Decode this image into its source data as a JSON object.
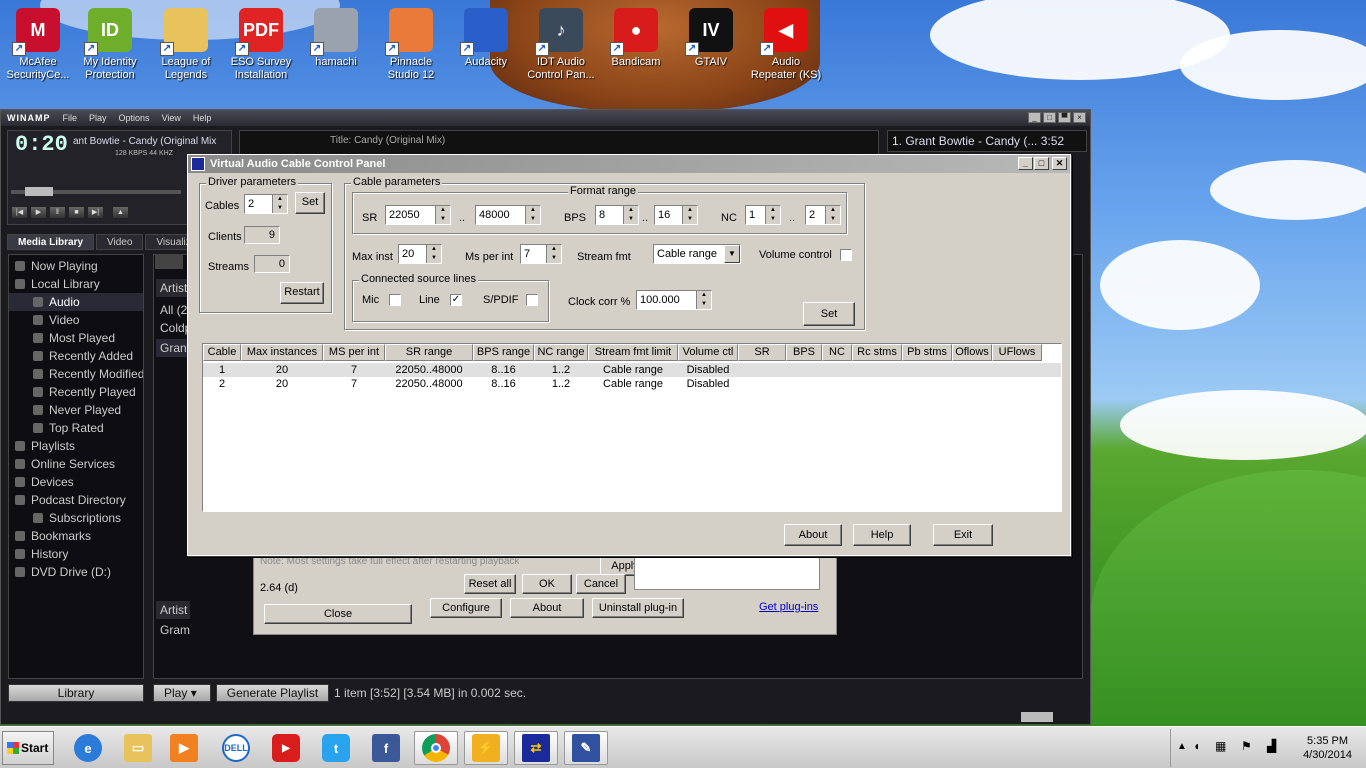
{
  "desktop": {
    "icons": [
      {
        "label1": "McAfee",
        "label2": "SecurityCe...",
        "icon": "mcafee-icon",
        "color": "#c8102e",
        "glyph": "M"
      },
      {
        "label1": "My Identity",
        "label2": "Protection",
        "icon": "identity-icon",
        "color": "#6fae2a",
        "glyph": "ID"
      },
      {
        "label1": "League of",
        "label2": "Legends",
        "icon": "folder-icon",
        "color": "#e8c25a",
        "glyph": ""
      },
      {
        "label1": "ESO Survey",
        "label2": "Installation",
        "icon": "pdf-icon",
        "color": "#e02424",
        "glyph": "PDF"
      },
      {
        "label1": "hamachi",
        "label2": "",
        "icon": "hamachi-icon",
        "color": "#9aa3ad",
        "glyph": ""
      },
      {
        "label1": "Pinnacle",
        "label2": "Studio 12",
        "icon": "pinnacle-icon",
        "color": "#e97a3a",
        "glyph": ""
      },
      {
        "label1": "Audacity",
        "label2": "",
        "icon": "audacity-icon",
        "color": "#2a5ec8",
        "glyph": ""
      },
      {
        "label1": "IDT Audio",
        "label2": "Control Pan...",
        "icon": "idt-audio-icon",
        "color": "#3a4a5a",
        "glyph": "♪"
      },
      {
        "label1": "Bandicam",
        "label2": "",
        "icon": "bandicam-icon",
        "color": "#d81c1c",
        "glyph": "●"
      },
      {
        "label1": "GTAIV",
        "label2": "",
        "icon": "gtaiv-icon",
        "color": "#111111",
        "glyph": "IV"
      },
      {
        "label1": "Audio",
        "label2": "Repeater (KS)",
        "icon": "audio-repeater-icon",
        "color": "#e01010",
        "glyph": "◀"
      }
    ]
  },
  "winamp": {
    "title": "WINAMP",
    "menu": [
      "File",
      "Play",
      "Options",
      "View",
      "Help"
    ],
    "time": "0:20",
    "track": "ant Bowtie - Candy (Original Mix",
    "kbps": "128 KBPS  44 KHZ",
    "video_title": "Title: Candy (Original Mix)",
    "playlist_entry": "1. Grant Bowtie - Candy (...   3:52",
    "tabs": [
      "Media Library",
      "Video",
      "Visualiza"
    ],
    "tree": [
      {
        "label": "Now Playing",
        "indent": 0,
        "sel": false
      },
      {
        "label": "Local Library",
        "indent": 0,
        "sel": false
      },
      {
        "label": "Audio",
        "indent": 1,
        "sel": true
      },
      {
        "label": "Video",
        "indent": 1,
        "sel": false
      },
      {
        "label": "Most Played",
        "indent": 1,
        "sel": false
      },
      {
        "label": "Recently Added",
        "indent": 1,
        "sel": false
      },
      {
        "label": "Recently Modified",
        "indent": 1,
        "sel": false
      },
      {
        "label": "Recently Played",
        "indent": 1,
        "sel": false
      },
      {
        "label": "Never Played",
        "indent": 1,
        "sel": false
      },
      {
        "label": "Top Rated",
        "indent": 1,
        "sel": false
      },
      {
        "label": "Playlists",
        "indent": 0,
        "sel": false
      },
      {
        "label": "Online Services",
        "indent": 0,
        "sel": false
      },
      {
        "label": "Devices",
        "indent": 0,
        "sel": false
      },
      {
        "label": "Podcast Directory",
        "indent": 0,
        "sel": false
      },
      {
        "label": "Subscriptions",
        "indent": 1,
        "sel": false
      },
      {
        "label": "Bookmarks",
        "indent": 0,
        "sel": false
      },
      {
        "label": "History",
        "indent": 0,
        "sel": false
      },
      {
        "label": "DVD Drive (D:)",
        "indent": 0,
        "sel": false
      }
    ],
    "artist_header": "Artist",
    "all_row": "All (2",
    "cold_row": "Coldp",
    "grant_row": "Grant",
    "artist_header2": "Artist",
    "grant_row2": "Gram",
    "library_button": "Library",
    "play_button": "Play",
    "generate_playlist": "Generate Playlist",
    "status": "1 item [3:52] [3.54 MB] in 0.002 sec."
  },
  "plugin_dialog": {
    "note": "Note: Most settings take full effect after restarting playback",
    "apply": "Apply",
    "reset_all": "Reset all",
    "ok": "OK",
    "cancel": "Cancel",
    "version": "2.64 (d)",
    "close": "Close",
    "configure": "Configure",
    "about": "About",
    "uninstall": "Uninstall plug-in",
    "get_plugins": "Get plug-ins"
  },
  "vac": {
    "title": "Virtual Audio Cable Control Panel",
    "driver": {
      "group": "Driver parameters",
      "cables_label": "Cables",
      "cables_value": "2",
      "set": "Set",
      "clients_label": "Clients",
      "clients_value": "9",
      "streams_label": "Streams",
      "streams_value": "0",
      "restart": "Restart"
    },
    "cable": {
      "group": "Cable parameters",
      "format_group": "Format range",
      "sr_label": "SR",
      "sr_min": "22050",
      "sr_max": "48000",
      "dots": "..",
      "bps_label": "BPS",
      "bps_min": "8",
      "bps_max": "16",
      "nc_label": "NC",
      "nc_min": "1",
      "nc_max": "2",
      "max_inst_label": "Max inst",
      "max_inst": "20",
      "ms_label": "Ms per int",
      "ms_value": "7",
      "stream_fmt_label": "Stream fmt",
      "stream_fmt_value": "Cable range",
      "volume_label": "Volume control",
      "source_group": "Connected source lines",
      "mic": "Mic",
      "line": "Line",
      "spdif": "S/PDIF",
      "line_checked": "✓",
      "clock_label": "Clock corr %",
      "clock_value": "100.000",
      "set": "Set"
    },
    "columns": [
      "Cable",
      "Max instances",
      "MS per int",
      "SR range",
      "BPS range",
      "NC range",
      "Stream fmt limit",
      "Volume ctl",
      "SR",
      "BPS",
      "NC",
      "Rc stms",
      "Pb stms",
      "Oflows",
      "UFlows"
    ],
    "rows": [
      [
        "1",
        "20",
        "7",
        "22050..48000",
        "8..16",
        "1..2",
        "Cable range",
        "Disabled",
        "",
        "",
        "",
        "",
        "",
        "",
        ""
      ],
      [
        "2",
        "20",
        "7",
        "22050..48000",
        "8..16",
        "1..2",
        "Cable range",
        "Disabled",
        "",
        "",
        "",
        "",
        "",
        "",
        ""
      ]
    ],
    "about": "About",
    "help": "Help",
    "exit": "Exit"
  },
  "taskbar": {
    "start": "Start",
    "time": "5:35 PM",
    "date": "4/30/2014"
  }
}
